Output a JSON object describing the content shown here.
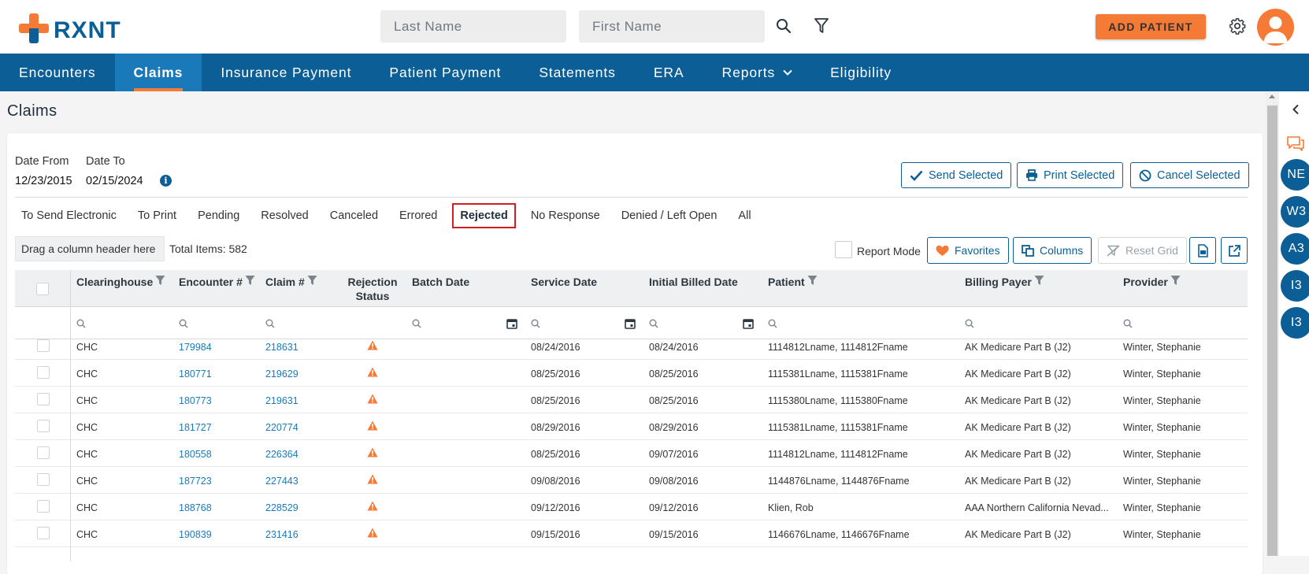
{
  "app": {
    "logo_text": "RXNT"
  },
  "header": {
    "last_name_placeholder": "Last Name",
    "first_name_placeholder": "First Name",
    "add_patient_label": "ADD PATIENT"
  },
  "nav": {
    "items": [
      {
        "label": "Encounters"
      },
      {
        "label": "Claims"
      },
      {
        "label": "Insurance Payment"
      },
      {
        "label": "Patient Payment"
      },
      {
        "label": "Statements"
      },
      {
        "label": "ERA"
      },
      {
        "label": "Reports"
      },
      {
        "label": "Eligibility"
      }
    ]
  },
  "page": {
    "title": "Claims"
  },
  "filters": {
    "date_from_label": "Date From",
    "date_from_value": "12/23/2015",
    "date_to_label": "Date To",
    "date_to_value": "02/15/2024"
  },
  "actions": {
    "send_selected": "Send Selected",
    "print_selected": "Print Selected",
    "cancel_selected": "Cancel Selected"
  },
  "tabs": [
    {
      "label": "To Send Electronic"
    },
    {
      "label": "To Print"
    },
    {
      "label": "Pending"
    },
    {
      "label": "Resolved"
    },
    {
      "label": "Canceled"
    },
    {
      "label": "Errored"
    },
    {
      "label": "Rejected"
    },
    {
      "label": "No Response"
    },
    {
      "label": "Denied / Left Open"
    },
    {
      "label": "All"
    }
  ],
  "active_tab": "Rejected",
  "toolbar": {
    "group_placeholder": "Drag a column header here",
    "total_items": "Total Items: 582",
    "report_mode": "Report Mode",
    "favorites": "Favorites",
    "columns": "Columns",
    "reset_grid": "Reset Grid"
  },
  "grid": {
    "columns": {
      "clearinghouse": "Clearinghouse",
      "encounter": "Encounter #",
      "claim": "Claim #",
      "rejection_status_1": "Rejection",
      "rejection_status_2": "Status",
      "batch_date": "Batch Date",
      "service_date": "Service Date",
      "initial_billed_date": "Initial Billed Date",
      "patient": "Patient",
      "billing_payer": "Billing Payer",
      "provider": "Provider"
    },
    "rows": [
      {
        "clearinghouse": "CHC",
        "encounter": "179984",
        "claim": "218631",
        "batch_date": "",
        "service_date": "08/24/2016",
        "initial_billed_date": "08/24/2016",
        "patient": "1114812Lname, 1114812Fname",
        "billing_payer": "AK Medicare Part B (J2)",
        "provider": "Winter, Stephanie"
      },
      {
        "clearinghouse": "CHC",
        "encounter": "180771",
        "claim": "219629",
        "batch_date": "",
        "service_date": "08/25/2016",
        "initial_billed_date": "08/25/2016",
        "patient": "1115381Lname, 1115381Fname",
        "billing_payer": "AK Medicare Part B (J2)",
        "provider": "Winter, Stephanie"
      },
      {
        "clearinghouse": "CHC",
        "encounter": "180773",
        "claim": "219631",
        "batch_date": "",
        "service_date": "08/25/2016",
        "initial_billed_date": "08/25/2016",
        "patient": "1115380Lname, 1115380Fname",
        "billing_payer": "AK Medicare Part B (J2)",
        "provider": "Winter, Stephanie"
      },
      {
        "clearinghouse": "CHC",
        "encounter": "181727",
        "claim": "220774",
        "batch_date": "",
        "service_date": "08/29/2016",
        "initial_billed_date": "08/29/2016",
        "patient": "1115381Lname, 1115381Fname",
        "billing_payer": "AK Medicare Part B (J2)",
        "provider": "Winter, Stephanie"
      },
      {
        "clearinghouse": "CHC",
        "encounter": "180558",
        "claim": "226364",
        "batch_date": "",
        "service_date": "08/25/2016",
        "initial_billed_date": "09/07/2016",
        "patient": "1114812Lname, 1114812Fname",
        "billing_payer": "AK Medicare Part B (J2)",
        "provider": "Winter, Stephanie"
      },
      {
        "clearinghouse": "CHC",
        "encounter": "187723",
        "claim": "227443",
        "batch_date": "",
        "service_date": "09/08/2016",
        "initial_billed_date": "09/08/2016",
        "patient": "1144876Lname, 1144876Fname",
        "billing_payer": "AK Medicare Part B (J2)",
        "provider": "Winter, Stephanie"
      },
      {
        "clearinghouse": "CHC",
        "encounter": "188768",
        "claim": "228529",
        "batch_date": "",
        "service_date": "09/12/2016",
        "initial_billed_date": "09/12/2016",
        "patient": "Klien, Rob",
        "billing_payer": "AAA Northern California Nevad...",
        "provider": "Winter, Stephanie"
      },
      {
        "clearinghouse": "CHC",
        "encounter": "190839",
        "claim": "231416",
        "batch_date": "",
        "service_date": "09/15/2016",
        "initial_billed_date": "09/15/2016",
        "patient": "1146676Lname, 1146676Fname",
        "billing_payer": "AK Medicare Part B (J2)",
        "provider": "Winter, Stephanie"
      }
    ]
  },
  "side_rail": {
    "badges": [
      "NE",
      "W3",
      "A3",
      "I3",
      "I3"
    ]
  },
  "colors": {
    "brand_blue": "#0b5f96",
    "accent_orange": "#f47a36",
    "link_blue": "#1a7ab9",
    "highlight_red": "#d21d23"
  }
}
